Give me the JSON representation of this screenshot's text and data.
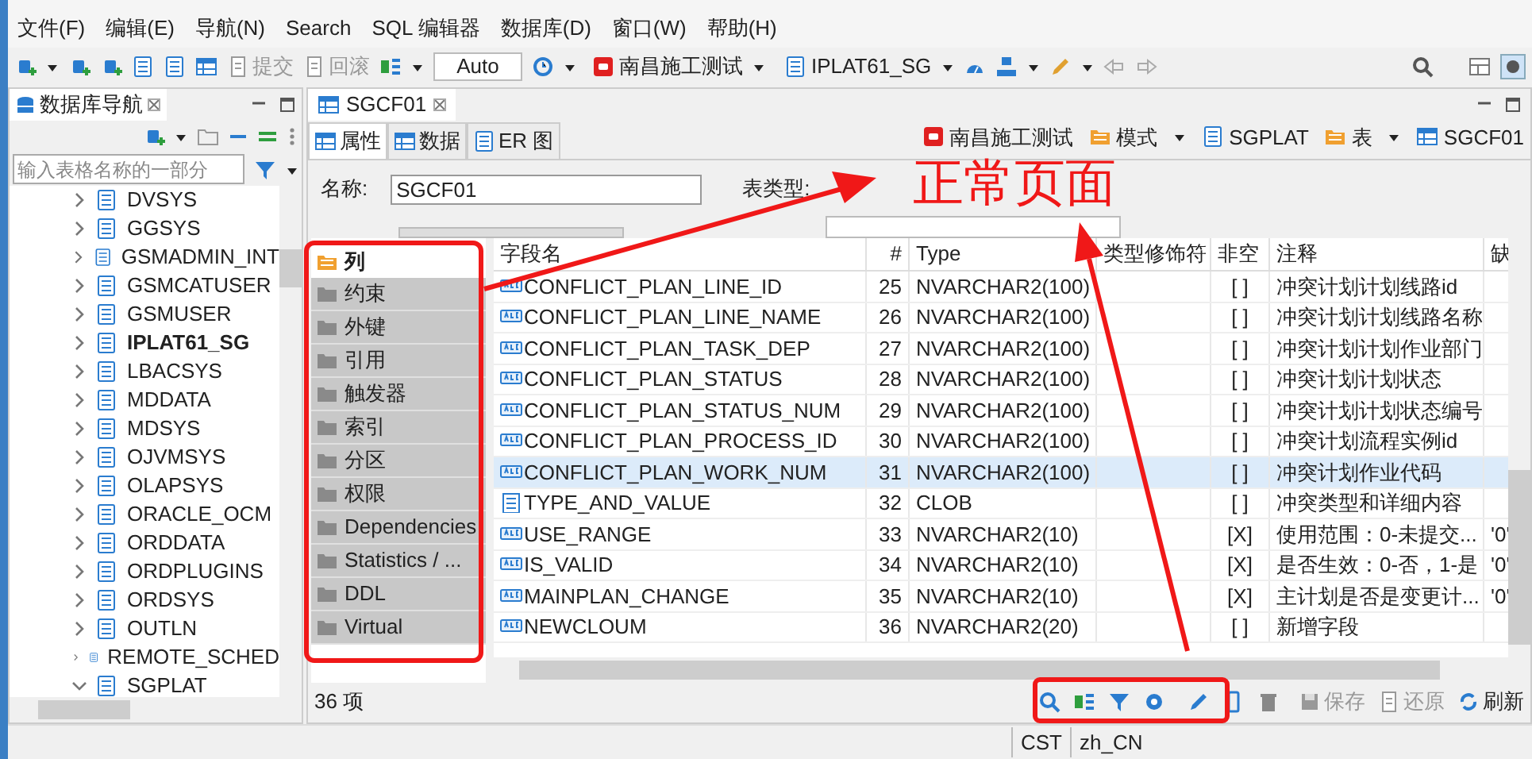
{
  "menu": [
    "文件(F)",
    "编辑(E)",
    "导航(N)",
    "Search",
    "SQL 编辑器",
    "数据库(D)",
    "窗口(W)",
    "帮助(H)"
  ],
  "toolbar": {
    "commit": "提交",
    "rollback": "回滚",
    "mode": "Auto",
    "connection": "南昌施工测试",
    "schema": "IPLAT61_SG"
  },
  "navigator": {
    "title": "数据库导航",
    "filter_placeholder": "输入表格名称的一部分",
    "items": [
      {
        "label": "DVSYS",
        "expanded": false,
        "active": false
      },
      {
        "label": "GGSYS",
        "expanded": false,
        "active": false
      },
      {
        "label": "GSMADMIN_INT",
        "expanded": false,
        "active": false
      },
      {
        "label": "GSMCATUSER",
        "expanded": false,
        "active": false
      },
      {
        "label": "GSMUSER",
        "expanded": false,
        "active": false
      },
      {
        "label": "IPLAT61_SG",
        "expanded": false,
        "active": true
      },
      {
        "label": "LBACSYS",
        "expanded": false,
        "active": false
      },
      {
        "label": "MDDATA",
        "expanded": false,
        "active": false
      },
      {
        "label": "MDSYS",
        "expanded": false,
        "active": false
      },
      {
        "label": "OJVMSYS",
        "expanded": false,
        "active": false
      },
      {
        "label": "OLAPSYS",
        "expanded": false,
        "active": false
      },
      {
        "label": "ORACLE_OCM",
        "expanded": false,
        "active": false
      },
      {
        "label": "ORDDATA",
        "expanded": false,
        "active": false
      },
      {
        "label": "ORDPLUGINS",
        "expanded": false,
        "active": false
      },
      {
        "label": "ORDSYS",
        "expanded": false,
        "active": false
      },
      {
        "label": "OUTLN",
        "expanded": false,
        "active": false
      },
      {
        "label": "REMOTE_SCHED",
        "expanded": false,
        "active": false
      },
      {
        "label": "SGPLAT",
        "expanded": true,
        "active": false
      }
    ]
  },
  "editor": {
    "tab": "SGCF01",
    "subtabs": [
      {
        "label": "属性",
        "selected": true
      },
      {
        "label": "数据",
        "selected": false
      },
      {
        "label": "ER 图",
        "selected": false
      }
    ],
    "breadcrumbs": [
      {
        "kind": "connection",
        "label": "南昌施工测试",
        "dropdown": false
      },
      {
        "kind": "folder",
        "label": "模式",
        "dropdown": true
      },
      {
        "kind": "schema",
        "label": "SGPLAT",
        "dropdown": false
      },
      {
        "kind": "folder",
        "label": "表",
        "dropdown": true
      },
      {
        "kind": "table",
        "label": "SGCF01",
        "dropdown": false
      }
    ],
    "form": {
      "name_label": "名称:",
      "name_value": "SGCF01",
      "type_label": "表类型:"
    },
    "sections": [
      {
        "label": "列",
        "selected": true
      },
      {
        "label": "约束",
        "selected": false
      },
      {
        "label": "外键",
        "selected": false
      },
      {
        "label": "引用",
        "selected": false
      },
      {
        "label": "触发器",
        "selected": false
      },
      {
        "label": "索引",
        "selected": false
      },
      {
        "label": "分区",
        "selected": false
      },
      {
        "label": "权限",
        "selected": false
      },
      {
        "label": "Dependencies",
        "selected": false
      },
      {
        "label": "Statistics / ...",
        "selected": false
      },
      {
        "label": "DDL",
        "selected": false
      },
      {
        "label": "Virtual",
        "selected": false
      }
    ],
    "table": {
      "columns": [
        "字段名",
        "#",
        "Type",
        "类型修饰符",
        "非空",
        "注释",
        "缺"
      ],
      "rows": [
        {
          "kind": "string",
          "name": "CONFLICT_PLAN_LINE_ID",
          "num": "25",
          "type": "NVARCHAR2(100)",
          "not_null": "[ ]",
          "comment": "冲突计划计划线路id",
          "selected": false
        },
        {
          "kind": "string",
          "name": "CONFLICT_PLAN_LINE_NAME",
          "num": "26",
          "type": "NVARCHAR2(100)",
          "not_null": "[ ]",
          "comment": "冲突计划计划线路名称",
          "selected": false
        },
        {
          "kind": "string",
          "name": "CONFLICT_PLAN_TASK_DEP",
          "num": "27",
          "type": "NVARCHAR2(100)",
          "not_null": "[ ]",
          "comment": "冲突计划计划作业部门",
          "selected": false
        },
        {
          "kind": "string",
          "name": "CONFLICT_PLAN_STATUS",
          "num": "28",
          "type": "NVARCHAR2(100)",
          "not_null": "[ ]",
          "comment": "冲突计划计划状态",
          "selected": false
        },
        {
          "kind": "string",
          "name": "CONFLICT_PLAN_STATUS_NUM",
          "num": "29",
          "type": "NVARCHAR2(100)",
          "not_null": "[ ]",
          "comment": "冲突计划计划状态编号",
          "selected": false
        },
        {
          "kind": "string",
          "name": "CONFLICT_PLAN_PROCESS_ID",
          "num": "30",
          "type": "NVARCHAR2(100)",
          "not_null": "[ ]",
          "comment": "冲突计划流程实例id",
          "selected": false
        },
        {
          "kind": "string",
          "name": "CONFLICT_PLAN_WORK_NUM",
          "num": "31",
          "type": "NVARCHAR2(100)",
          "not_null": "[ ]",
          "comment": "冲突计划作业代码",
          "selected": true
        },
        {
          "kind": "clob",
          "name": "TYPE_AND_VALUE",
          "num": "32",
          "type": "CLOB",
          "not_null": "[ ]",
          "comment": "冲突类型和详细内容",
          "selected": false
        },
        {
          "kind": "string",
          "name": "USE_RANGE",
          "num": "33",
          "type": "NVARCHAR2(10)",
          "not_null": "[X]",
          "comment": "使用范围：0-未提交...",
          "default": "'0'",
          "selected": false
        },
        {
          "kind": "string",
          "name": "IS_VALID",
          "num": "34",
          "type": "NVARCHAR2(10)",
          "not_null": "[X]",
          "comment": "是否生效：0-否，1-是",
          "default": "'0'",
          "selected": false
        },
        {
          "kind": "string",
          "name": "MAINPLAN_CHANGE",
          "num": "35",
          "type": "NVARCHAR2(10)",
          "not_null": "[X]",
          "comment": "主计划是否是变更计...",
          "default": "'0'",
          "selected": false
        },
        {
          "kind": "string",
          "name": "NEWCLOUM",
          "num": "36",
          "type": "NVARCHAR2(20)",
          "not_null": "[ ]",
          "comment": "新增字段",
          "selected": false
        }
      ]
    },
    "footer": {
      "count": "36 项",
      "save": "保存",
      "revert": "还原",
      "refresh": "刷新"
    }
  },
  "status_bar": [
    "CST",
    "zh_CN"
  ],
  "annotation": {
    "text": "正常页面"
  }
}
